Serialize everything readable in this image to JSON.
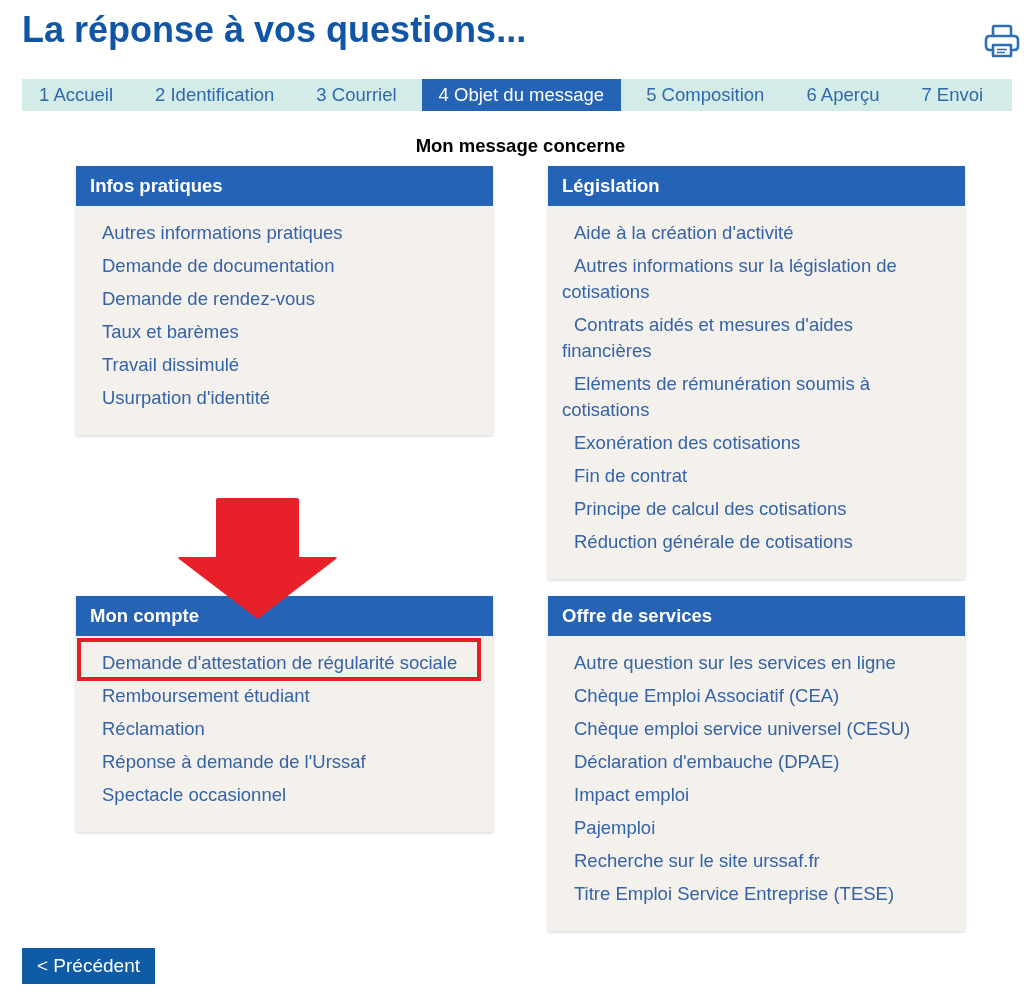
{
  "title": "La réponse à vos questions...",
  "steps": [
    {
      "label": "1 Accueil",
      "selected": false
    },
    {
      "label": "2 Identification",
      "selected": false
    },
    {
      "label": "3 Courriel",
      "selected": false
    },
    {
      "label": "4 Objet du message",
      "selected": true
    },
    {
      "label": "5 Composition",
      "selected": false
    },
    {
      "label": "6 Aperçu",
      "selected": false
    },
    {
      "label": "7 Envoi",
      "selected": false
    }
  ],
  "prompt": "Mon message concerne",
  "panels": [
    {
      "title": "Infos pratiques",
      "items": [
        {
          "label": "Autres informations pratiques",
          "highlighted": false
        },
        {
          "label": "Demande de documentation",
          "highlighted": false
        },
        {
          "label": "Demande de rendez-vous",
          "highlighted": false
        },
        {
          "label": "Taux et barèmes",
          "highlighted": false
        },
        {
          "label": "Travail dissimulé",
          "highlighted": false
        },
        {
          "label": "Usurpation d'identité",
          "highlighted": false
        }
      ]
    },
    {
      "title": "Législation",
      "items": [
        {
          "label": "Aide à la création d'activité",
          "highlighted": false
        },
        {
          "label": "Autres informations sur la législation de cotisations",
          "highlighted": false
        },
        {
          "label": "Contrats aidés et mesures d'aides financières",
          "highlighted": false
        },
        {
          "label": "Eléments de rémunération soumis à cotisations",
          "highlighted": false
        },
        {
          "label": "Exonération des cotisations",
          "highlighted": false
        },
        {
          "label": "Fin de contrat",
          "highlighted": false
        },
        {
          "label": "Principe de calcul des cotisations",
          "highlighted": false
        },
        {
          "label": "Réduction générale de cotisations",
          "highlighted": false
        }
      ]
    },
    {
      "title": "Mon compte",
      "items": [
        {
          "label": "Demande d'attestation de régularité sociale",
          "highlighted": true
        },
        {
          "label": "Remboursement étudiant",
          "highlighted": false
        },
        {
          "label": "Réclamation",
          "highlighted": false
        },
        {
          "label": "Réponse à demande de l'Urssaf",
          "highlighted": false
        },
        {
          "label": "Spectacle occasionnel",
          "highlighted": false
        }
      ]
    },
    {
      "title": "Offre de services",
      "items": [
        {
          "label": "Autre question sur les services en ligne",
          "highlighted": false
        },
        {
          "label": "Chèque Emploi Associatif (CEA)",
          "highlighted": false
        },
        {
          "label": "Chèque emploi service universel (CESU)",
          "highlighted": false
        },
        {
          "label": "Déclaration d'embauche (DPAE)",
          "highlighted": false
        },
        {
          "label": "Impact emploi",
          "highlighted": false
        },
        {
          "label": "Pajemploi",
          "highlighted": false
        },
        {
          "label": "Recherche sur le site urssaf.fr",
          "highlighted": false
        },
        {
          "label": "Titre Emploi Service Entreprise (TESE)",
          "highlighted": false
        }
      ]
    }
  ],
  "back_button": "< Précédent"
}
